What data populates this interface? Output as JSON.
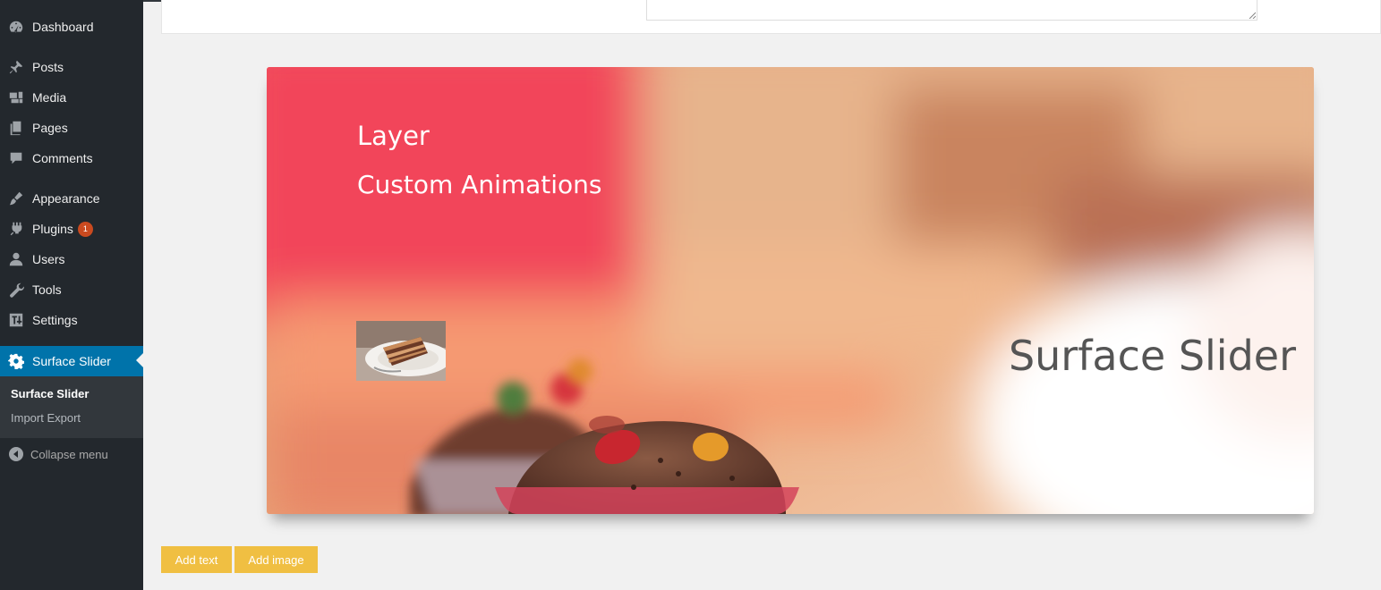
{
  "sidebar": {
    "items": [
      {
        "label": "Dashboard",
        "icon": "dashboard-icon"
      },
      {
        "label": "Posts",
        "icon": "pin-icon"
      },
      {
        "label": "Media",
        "icon": "media-icon"
      },
      {
        "label": "Pages",
        "icon": "pages-icon"
      },
      {
        "label": "Comments",
        "icon": "comment-icon"
      },
      {
        "label": "Appearance",
        "icon": "brush-icon"
      },
      {
        "label": "Plugins",
        "icon": "plug-icon",
        "badge": "1"
      },
      {
        "label": "Users",
        "icon": "user-icon"
      },
      {
        "label": "Tools",
        "icon": "wrench-icon"
      },
      {
        "label": "Settings",
        "icon": "settings-icon"
      },
      {
        "label": "Surface Slider",
        "icon": "gear-icon"
      }
    ],
    "submenu": [
      {
        "label": "Surface Slider"
      },
      {
        "label": "Import Export"
      }
    ],
    "collapse_label": "Collapse menu"
  },
  "slider": {
    "layers": [
      {
        "text": "Layer"
      },
      {
        "text": "Custom Animations"
      },
      {
        "text": "Surface Slider"
      }
    ]
  },
  "buttons": {
    "add_text": "Add text",
    "add_image": "Add image"
  },
  "colors": {
    "sidebar_bg": "#23282d",
    "active_bg": "#0073aa",
    "button_bg": "#f0bf42",
    "badge_bg": "#ca4a1f"
  }
}
